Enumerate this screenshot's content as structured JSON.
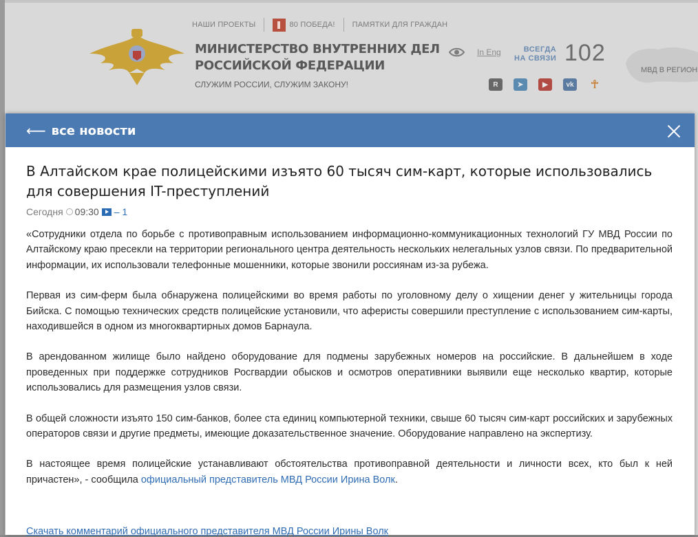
{
  "header": {
    "nav": [
      "НАШИ ПРОЕКТЫ",
      "80 ПОБЕДА!",
      "ПАМЯТКИ ДЛЯ ГРАЖДАН"
    ],
    "title_line1": "МИНИСТЕРСТВО ВНУТРЕННИХ ДЕЛ",
    "title_line2": "РОССИЙСКОЙ ФЕДЕРАЦИИ",
    "slogan": "СЛУЖИМ РОССИИ, СЛУЖИМ ЗАКОНУ!",
    "lang": "In Eng",
    "always_line1": "ВСЕГДА",
    "always_line2": "НА СВЯЗИ",
    "hotline": "102",
    "region": "МВД В РЕГИОН",
    "socials": [
      "rutube",
      "telegram",
      "youtube",
      "vk",
      "odnoklassniki"
    ]
  },
  "modal": {
    "back_label": "все новости",
    "headline": "В Алтайском крае полицейскими изъято 60 тысяч сим-карт, которые использовались для совершения IT-преступлений",
    "date": "Сегодня",
    "time": "09:30",
    "video_count": "– 1",
    "paragraphs": [
      "«Сотрудники отдела по борьбе с противоправным использованием информационно-коммуникационных технологий ГУ МВД России по Алтайскому краю пресекли на территории регионального центра деятельность нескольких нелегальных узлов связи. По предварительной информации, их использовали телефонные мошенники, которые звонили россиянам из-за рубежа.",
      "Первая из сим-ферм была обнаружена полицейскими во время работы по уголовному делу о хищении денег у жительницы города Бийска. С помощью технических средств полицейские установили, что аферисты совершили преступление с использованием сим-карты, находившейся в одном из многоквартирных домов Барнаула.",
      "В арендованном жилище было найдено оборудование для подмены зарубежных номеров на российские. В дальнейшем в ходе проведенных при поддержке сотрудников Росгвардии обысков и осмотров оперативники выявили еще несколько квартир, которые использовались для размещения узлов связи.",
      "В общей сложности изъято 150 сим-банков, более ста единиц компьютерной техники, свыше 60 тысяч сим-карт российских и зарубежных операторов связи и другие предметы, имеющие доказательственное значение. Оборудование направлено на экспертизу."
    ],
    "last_paragraph_text": "В настоящее время полицейские устанавливают обстоятельства противоправной деятельности и личности всех, кто был к ней причастен», - сообщила ",
    "last_paragraph_link": "официальный представитель МВД России Ирина Волк",
    "last_paragraph_end": ".",
    "download_link": "Скачать комментарий официального представителя МВД России Ирины Волк"
  },
  "colors": {
    "modal_bar": "#4b7ab2",
    "link": "#2f6cb4",
    "backdrop": "#d9d9d9"
  }
}
